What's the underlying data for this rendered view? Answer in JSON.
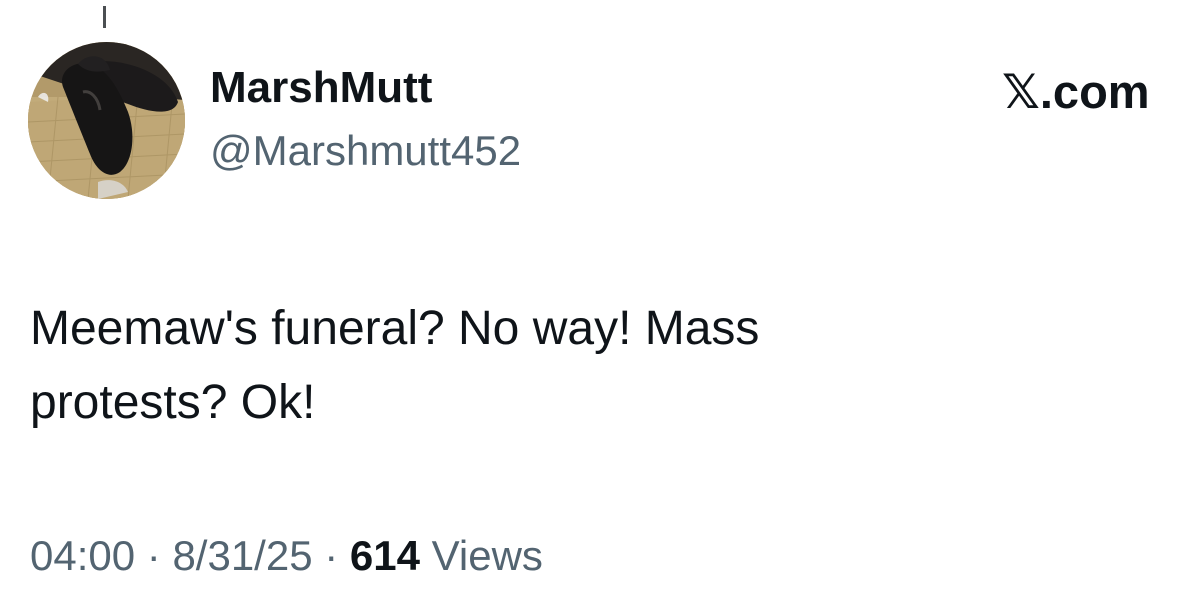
{
  "author": {
    "display_name": "MarshMutt",
    "handle": "@Marshmutt452",
    "avatar_icon": "dog-avatar-icon"
  },
  "brand": {
    "label": "𝕏.com"
  },
  "tweet": {
    "text": "Meemaw's funeral?  No way!  Mass\nprotests?   Ok!"
  },
  "meta": {
    "time": "04:00",
    "separator_1": " · ",
    "date": "8/31/25",
    "separator_2": " · ",
    "views_count": "614",
    "views_label": " Views"
  },
  "colors": {
    "text_primary": "#0f1419",
    "text_secondary": "#536471",
    "background": "#ffffff"
  }
}
